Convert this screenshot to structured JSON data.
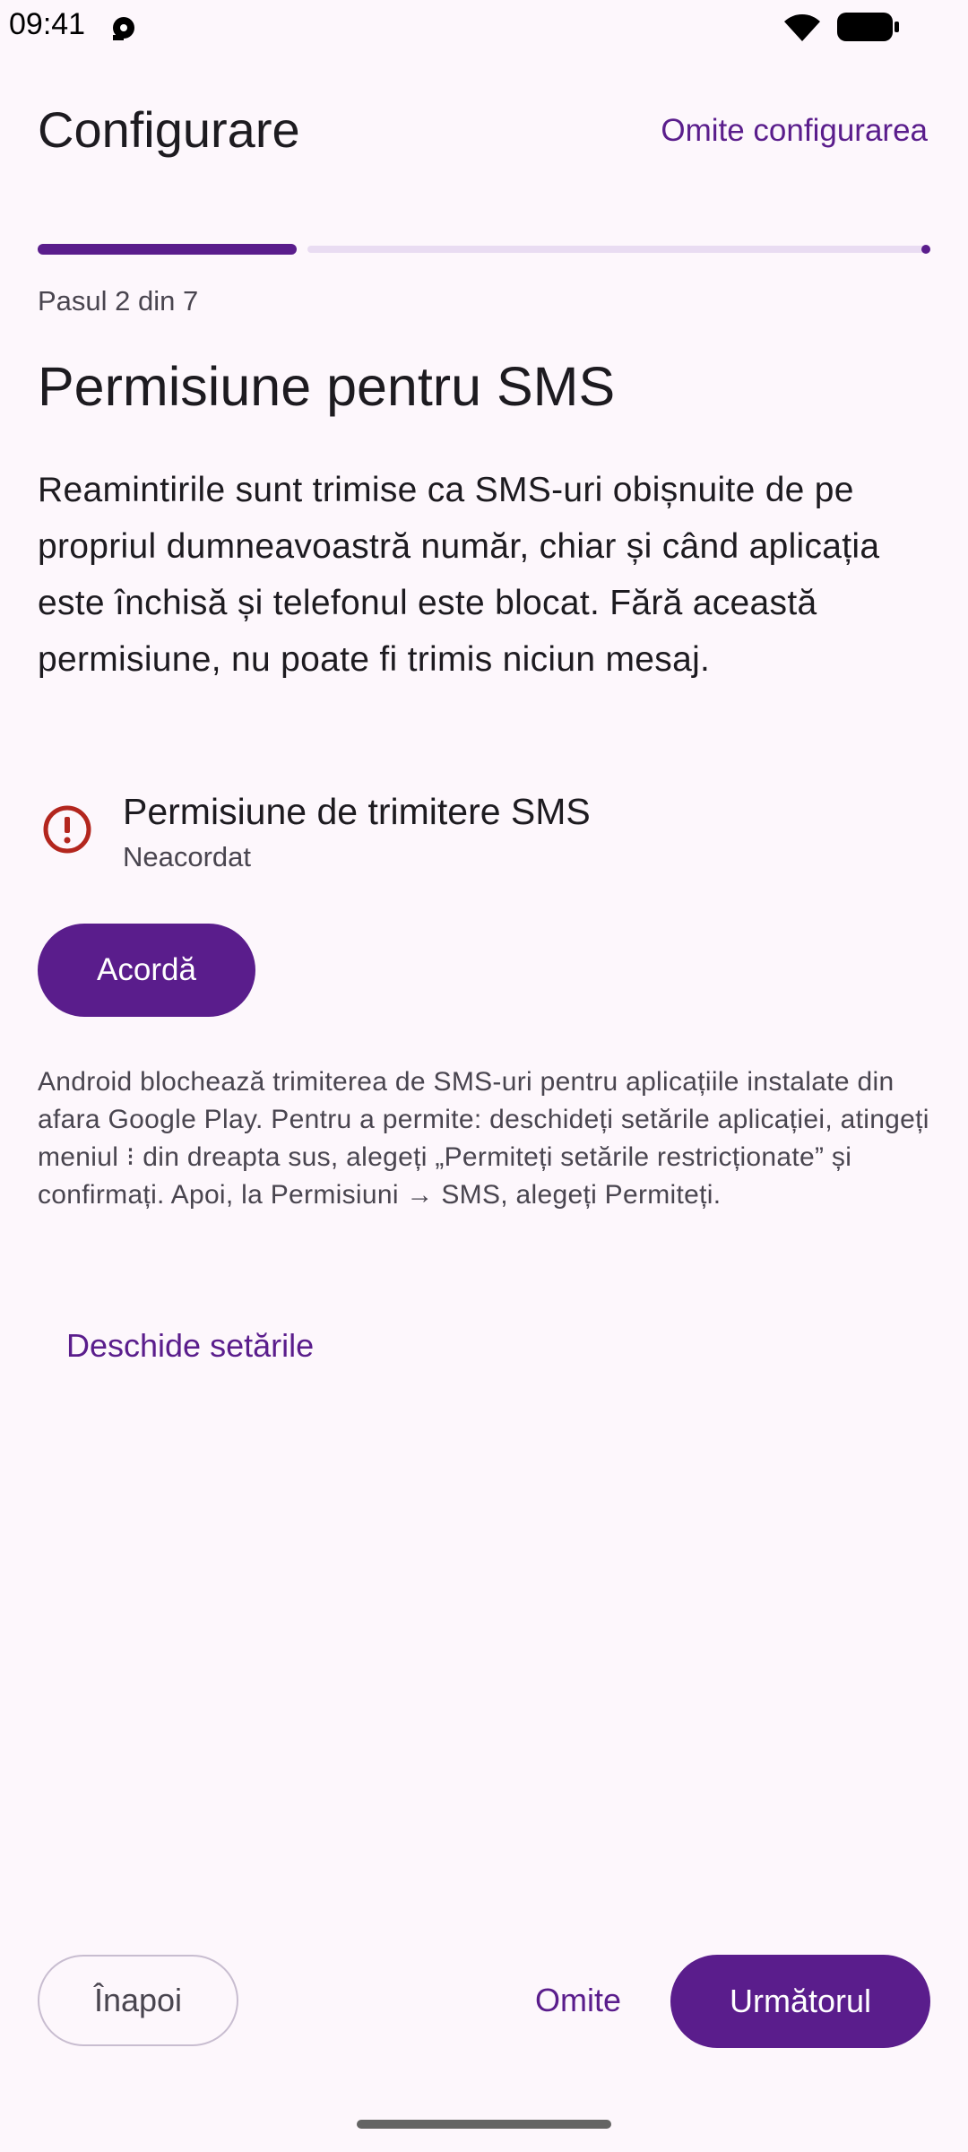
{
  "status_bar": {
    "time": "09:41",
    "icons": [
      "notification-icon",
      "wifi-icon",
      "battery-icon"
    ]
  },
  "header": {
    "title": "Configurare",
    "skip_link": "Omite configurarea"
  },
  "progress": {
    "current_step": 2,
    "total_steps": 7,
    "fraction": 0.29,
    "label": "Pasul 2 din 7"
  },
  "main": {
    "heading": "Permisiune pentru SMS",
    "description": "Reamintirile sunt trimise ca SMS-uri obișnuite de pe propriul dumneavoastră număr, chiar și când aplicația este închisă și telefonul este blocat. Fără această permisiune, nu poate fi trimis niciun mesaj.",
    "permission": {
      "icon": "error-icon",
      "name": "Permisiune de trimitere SMS",
      "status": "Neacordat"
    },
    "grant_label": "Acordă",
    "note": "Android blochează trimiterea de SMS-uri pentru aplicațiile instalate din afara Google Play. Pentru a permite: deschideți setările aplicației, atingeți meniul ⁝ din dreapta sus, alegeți „Permiteți setările restricționate” și confirmați. Apoi, la Permisiuni → SMS, alegeți Permiteți.",
    "open_settings_label": "Deschide setările"
  },
  "footer": {
    "back_label": "Înapoi",
    "skip_label": "Omite",
    "next_label": "Următorul"
  },
  "colors": {
    "accent": "#5a1d8c",
    "accent_light": "#e9dcf2",
    "error": "#b3261e",
    "background": "#fdf7fc"
  }
}
